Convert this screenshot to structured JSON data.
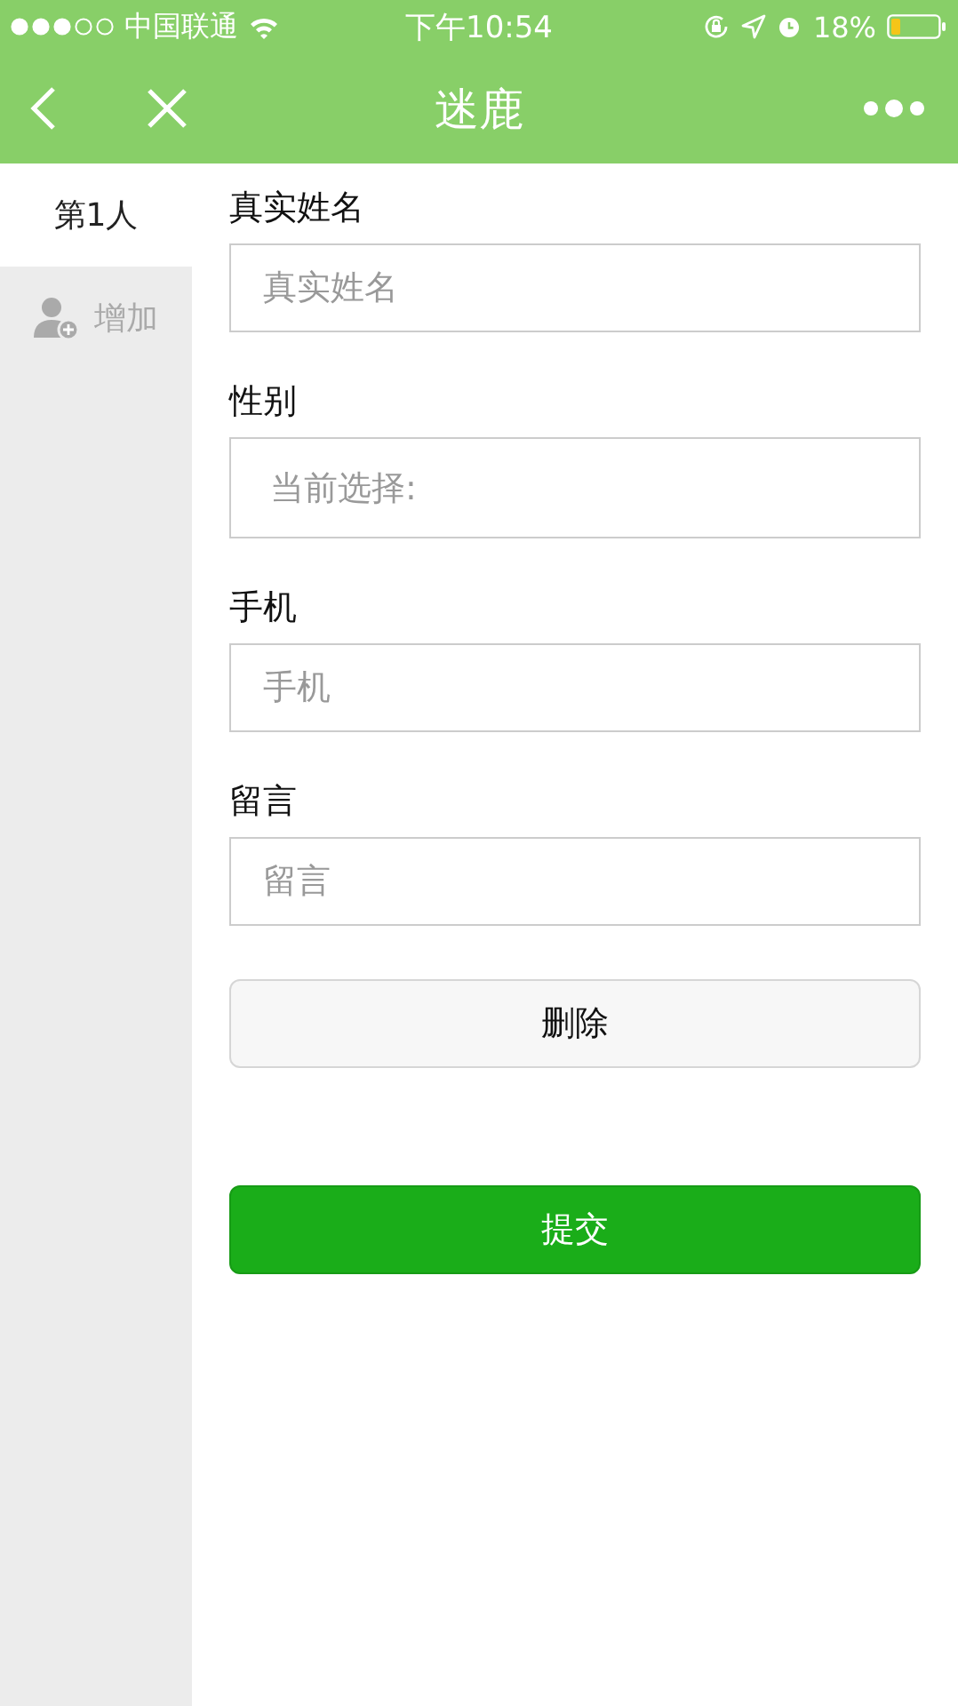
{
  "status_bar": {
    "carrier": "中国联通",
    "time": "下午10:54",
    "battery": "18%"
  },
  "nav_bar": {
    "title": "迷鹿"
  },
  "sidebar": {
    "items": [
      {
        "kind": "person",
        "label": "第1人",
        "selected": true
      },
      {
        "kind": "add",
        "label": "增加",
        "selected": false
      }
    ]
  },
  "form": {
    "fields": [
      {
        "kind": "input",
        "label": "真实姓名",
        "placeholder": "真实姓名"
      },
      {
        "kind": "picker",
        "label": "性别",
        "value": "当前选择:"
      },
      {
        "kind": "input",
        "label": "手机",
        "placeholder": "手机"
      },
      {
        "kind": "input",
        "label": "留言",
        "placeholder": "留言"
      }
    ],
    "delete_button": "删除",
    "submit_button": "提交"
  }
}
